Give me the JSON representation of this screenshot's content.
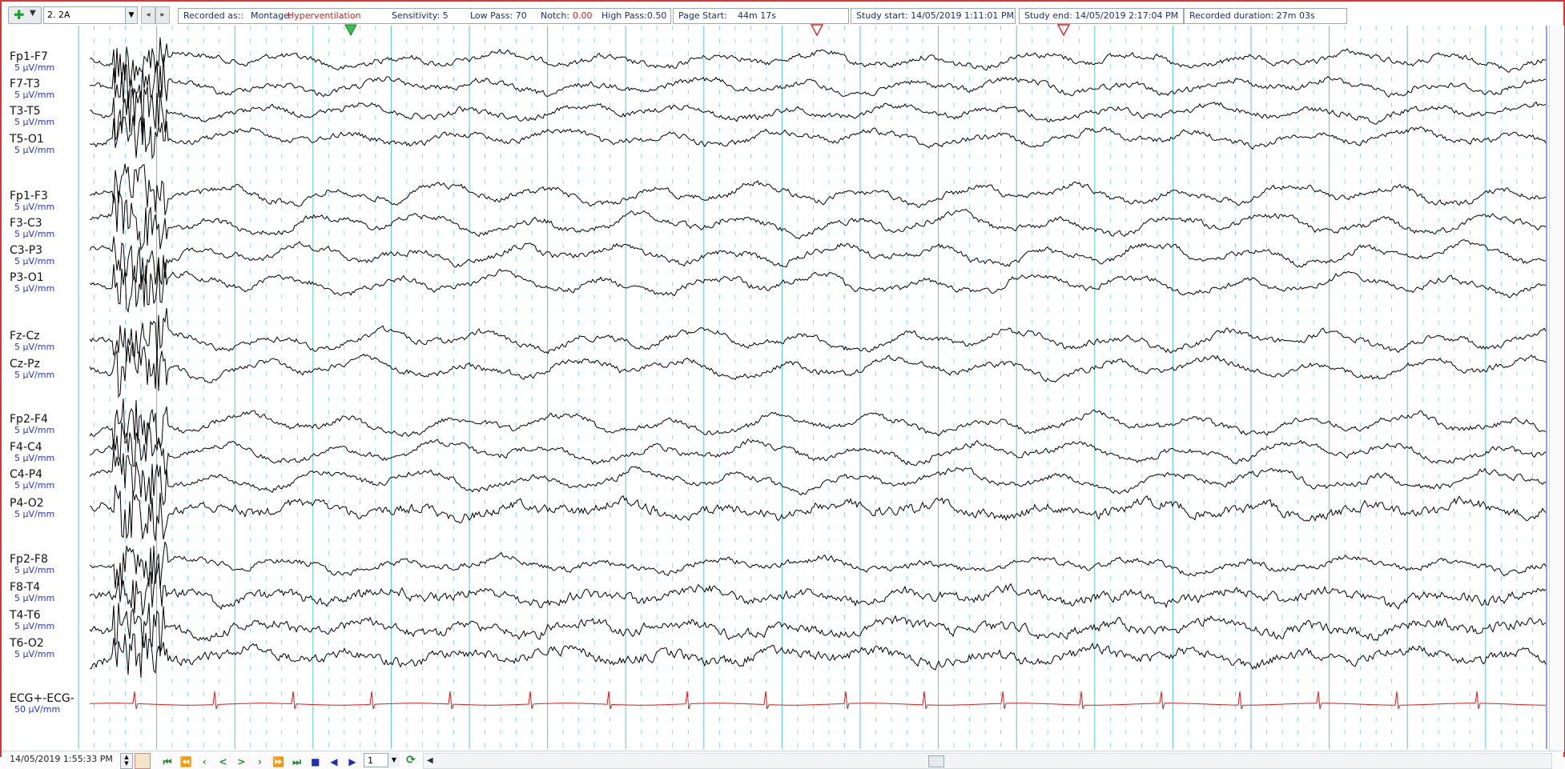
{
  "toolbar": {
    "montage_select": "2. 2A",
    "recorded_as_label": "Recorded as::",
    "montage_label": "Montage:",
    "montage_value": "Hyperventilation",
    "sensitivity_label": "Sensitivity: 5",
    "low_pass_label": "Low Pass: 70",
    "notch_label": "Notch:",
    "notch_value": "0.00",
    "high_pass_label": "High Pass:0.50",
    "page_start_label": "Page Start:",
    "page_start_value": "44m 17s",
    "study_start": "Study start: 14/05/2019 1:11:01 PM",
    "study_end": "Study end: 14/05/2019 2:17:04 PM",
    "recorded_duration": "Recorded duration: 27m 03s"
  },
  "channels": [
    {
      "name": "Fp1-F7",
      "sens": "5 µV/mm"
    },
    {
      "name": "F7-T3",
      "sens": "5 µV/mm"
    },
    {
      "name": "T3-T5",
      "sens": "5 µV/mm"
    },
    {
      "name": "T5-O1",
      "sens": "5 µV/mm"
    },
    {
      "name": "Fp1-F3",
      "sens": "5 µV/mm"
    },
    {
      "name": "F3-C3",
      "sens": "5 µV/mm"
    },
    {
      "name": "C3-P3",
      "sens": "5 µV/mm"
    },
    {
      "name": "P3-O1",
      "sens": "5 µV/mm"
    },
    {
      "name": "Fz-Cz",
      "sens": "5 µV/mm"
    },
    {
      "name": "Cz-Pz",
      "sens": "5 µV/mm"
    },
    {
      "name": "Fp2-F4",
      "sens": "5 µV/mm"
    },
    {
      "name": "F4-C4",
      "sens": "5 µV/mm"
    },
    {
      "name": "C4-P4",
      "sens": "5 µV/mm"
    },
    {
      "name": "P4-O2",
      "sens": "5 µV/mm"
    },
    {
      "name": "Fp2-F8",
      "sens": "5 µV/mm"
    },
    {
      "name": "F8-T4",
      "sens": "5 µV/mm"
    },
    {
      "name": "T4-T6",
      "sens": "5 µV/mm"
    },
    {
      "name": "T6-O2",
      "sens": "5 µV/mm"
    },
    {
      "name": "ECG+-ECG-",
      "sens": "50 µV/mm"
    }
  ],
  "bottom": {
    "datetime": "14/05/2019   1:55:33 PM",
    "page_number": "1"
  },
  "colors": {
    "trace": "#000000",
    "ecg_trace": "#e01717",
    "grid": "#53c7d3",
    "sens_text": "#2633d6",
    "frame": "#dd3333"
  }
}
